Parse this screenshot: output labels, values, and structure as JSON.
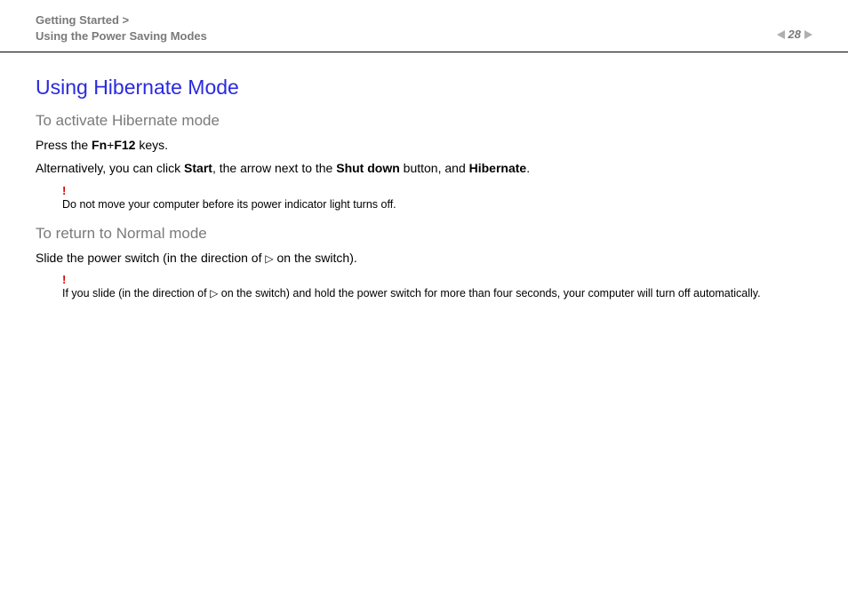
{
  "header": {
    "breadcrumb_line1": "Getting Started >",
    "breadcrumb_line2": "Using the Power Saving Modes",
    "page_number": "28"
  },
  "main": {
    "title": "Using Hibernate Mode",
    "section1": {
      "heading": "To activate Hibernate mode",
      "p1_pre": "Press the ",
      "p1_b1": "Fn",
      "p1_mid": "+",
      "p1_b2": "F12",
      "p1_post": " keys.",
      "p2_pre": "Alternatively, you can click ",
      "p2_b1": "Start",
      "p2_mid1": ", the arrow next to the ",
      "p2_b2": "Shut down",
      "p2_mid2": " button, and ",
      "p2_b3": "Hibernate",
      "p2_post": ".",
      "warn_bang": "!",
      "warn_text": "Do not move your computer before its power indicator light turns off."
    },
    "section2": {
      "heading": "To return to Normal mode",
      "p1_pre": "Slide the power switch (in the direction of ",
      "p1_tri": "▷",
      "p1_post": " on the switch).",
      "warn_bang": "!",
      "warn_pre": "If you slide (in the direction of ",
      "warn_tri": "▷",
      "warn_post": " on the switch) and hold the power switch for more than four seconds, your computer will turn off automatically."
    }
  }
}
